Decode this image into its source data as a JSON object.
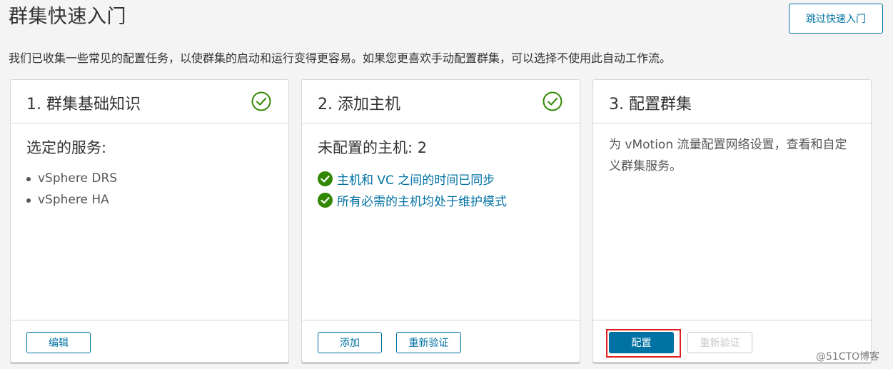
{
  "header": {
    "title": "群集快速入门",
    "skip_label": "跳过快速入门",
    "description": "我们已收集一些常见的配置任务，以使群集的启动和运行变得更容易。如果您更喜欢手动配置群集，可以选择不使用此自动工作流。"
  },
  "cards": [
    {
      "title": "1. 群集基础知识",
      "completed": true,
      "heading": "选定的服务:",
      "services": [
        "vSphere DRS",
        "vSphere HA"
      ],
      "edit_label": "编辑"
    },
    {
      "title": "2. 添加主机",
      "completed": true,
      "heading": "未配置的主机: 2",
      "checks": [
        "主机和 VC 之间的时间已同步",
        "所有必需的主机均处于维护模式"
      ],
      "add_label": "添加",
      "revalidate_label": "重新验证"
    },
    {
      "title": "3. 配置群集",
      "completed": false,
      "description": "为 vMotion 流量配置网络设置，查看和自定义群集服务。",
      "configure_label": "配置",
      "revalidate_label": "重新验证",
      "revalidate_disabled": true
    }
  ],
  "colors": {
    "accent": "#0072a3",
    "success": "#318700",
    "highlight": "#e02020"
  },
  "watermark": "@51CTO博客"
}
